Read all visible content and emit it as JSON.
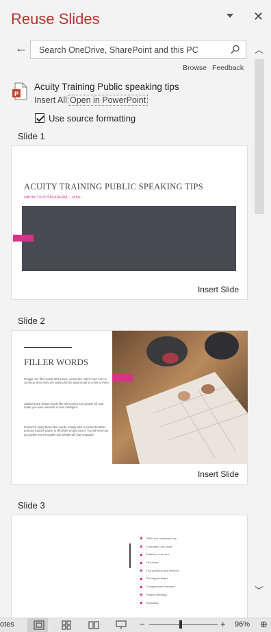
{
  "pane": {
    "title": "Reuse Slides"
  },
  "search": {
    "placeholder": "Search OneDrive, SharePoint and this PC"
  },
  "links": {
    "browse": "Browse",
    "feedback": "Feedback"
  },
  "file": {
    "name": "Acuity Training Public speaking tips",
    "insert_all": "Insert All",
    "open_in": "Open in PowerPoint"
  },
  "options": {
    "use_source_formatting": "Use source formatting",
    "checked": true
  },
  "slides": [
    {
      "label": "Slide 1",
      "insert": "Insert Slide",
      "title": "ACUITY TRAINING PUBLIC SPEAKING TIPS",
      "subtitle": "with the TOUCH ACADEMIA ... of the ..."
    },
    {
      "label": "Slide 2",
      "insert": "Insert Slide",
      "title": "FILLER WORDS",
      "paragraphs": [
        "Google use filler words all the time, words like \"umm\" and \"um\" is common when they are waiting for the right words to come to them.",
        "Studies have shown words like this tend to turn people off, and make you seem nervous or less intelligent.",
        "Instead of using these filler words, simply take a mental breather and use that the pause to fill all the empty sound. You will seem as you gather your thoughts and people will stay engaged."
      ]
    },
    {
      "label": "Slide 3",
      "bullets": [
        "What our customers say",
        "Customer case study",
        "Industry overview",
        "Our team",
        "Our products and services",
        "Pricing/packages",
        "Company performance",
        "Future offerings",
        "Roadmap"
      ]
    }
  ],
  "status": {
    "notes": "otes",
    "zoom": "96%"
  },
  "colors": {
    "title_red": "#b8322d",
    "accent_pink": "#d8328a",
    "slide_dark": "#4a4a52"
  }
}
